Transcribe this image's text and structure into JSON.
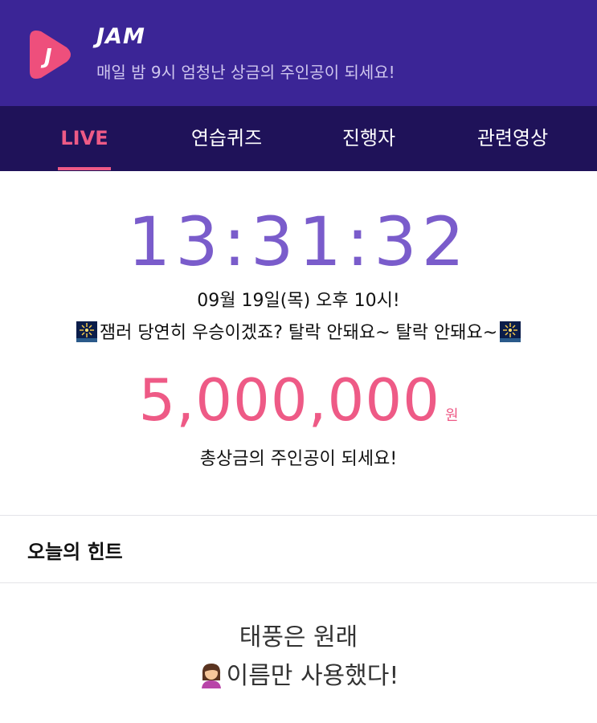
{
  "app": {
    "name": "JAM",
    "logo_letter": "J",
    "tagline": "매일 밤 9시 엄청난 상금의 주인공이 되세요!",
    "colors": {
      "header": "#3b2596",
      "tabbar": "#1f1259",
      "accent": "#ee5a86",
      "timer": "#7a5ccb"
    }
  },
  "tabs": [
    {
      "label": "LIVE",
      "active": true
    },
    {
      "label": "연습퀴즈",
      "active": false
    },
    {
      "label": "진행자",
      "active": false
    },
    {
      "label": "관련영상",
      "active": false
    }
  ],
  "live": {
    "countdown": "13:31:32",
    "date": "09월 19일(목) 오후 10시!",
    "message": "잼러 당연히 우승이겠죠? 탈락 안돼요~ 탈락 안돼요~",
    "message_icon": "fireworks-icon",
    "prize_amount": "5,000,000",
    "prize_unit": "원",
    "prize_caption": "총상금의 주인공이 되세요!"
  },
  "hint": {
    "title": "오늘의 힌트",
    "line1": "태풍은 원래",
    "line2": "이름만 사용했다!",
    "line2_icon": "woman-icon"
  }
}
